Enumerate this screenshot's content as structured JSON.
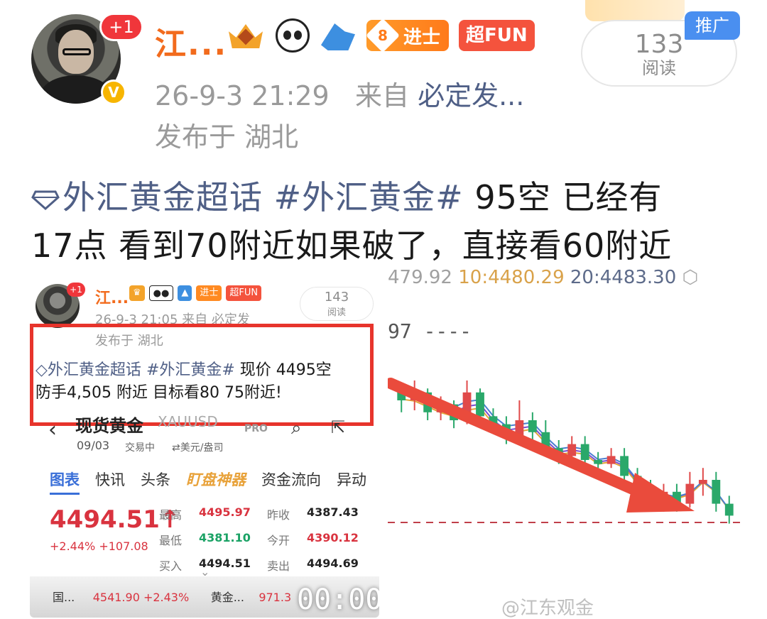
{
  "header": {
    "username": "江...",
    "plus_badge": "+1",
    "level_badge": "8",
    "level_title": "进士",
    "fun_badge": "超FUN",
    "date_time": "26-9-3 21:29",
    "source_prefix": "来自",
    "source_app": "必定发...",
    "location": "发布于 湖北",
    "read_count": "133",
    "read_label": "阅读",
    "promo_tag": "推广"
  },
  "post": {
    "topic1": "外汇黄金超话",
    "topic2": "#外汇黄金#",
    "text_line1": " 95空 已经有",
    "text_line2": "17点 看到70附近如果破了，直接看60附近"
  },
  "left_screenshot": {
    "name": "江...",
    "read_count": "143",
    "read_label": "阅读",
    "level_title": "进士",
    "fun_badge": "超FUN",
    "meta": "26-9-3 21:05 来自 必定发",
    "location": "发布于 湖北",
    "topic1": "外汇黄金超话",
    "topic2": "#外汇黄金#",
    "post_line1": " 现价 4495空",
    "post_line2": "防手4,505 附近 目标看80  75附近!",
    "app": {
      "title": "现货黄金",
      "symbol": "XAUUSD",
      "pro": "PRO",
      "date": "09/03",
      "status": "交易中",
      "unit": "⇄美元/盎司",
      "tabs": [
        "图表",
        "快讯",
        "头条",
        "盯盘神器",
        "资金流向",
        "异动"
      ],
      "price": "4494.51↑",
      "change": "+2.44%  +107.08",
      "quotes": [
        {
          "k": "最高",
          "v": "4495.97",
          "c": "up"
        },
        {
          "k": "昨收",
          "v": "4387.43",
          "c": "v"
        },
        {
          "k": "最低",
          "v": "4381.10",
          "c": "dn"
        },
        {
          "k": "今开",
          "v": "4390.12",
          "c": "up"
        },
        {
          "k": "买入",
          "v": "4494.51",
          "c": "v"
        },
        {
          "k": "卖出",
          "v": "4494.69",
          "c": "v"
        }
      ],
      "ticker_name": "国...",
      "ticker_value": "4541.90 +2.43%",
      "ticker_name2": "黄金...",
      "ticker_value2": "971.3",
      "timestamp": "00:00"
    }
  },
  "chart": {
    "header_left": "479.92",
    "header_mid": "10:4480.29",
    "header_right": "20:4483.30",
    "level_label": "97 ----",
    "watermark": "@江东观金",
    "colors": {
      "up": "#e04a4a",
      "down": "#2aa86a",
      "arrow": "#ea4b3c",
      "ma5": "#7a4fd0",
      "ma10": "#e2a43a",
      "ma20": "#4a7fd0"
    },
    "candles": [
      {
        "o": 0.24,
        "c": 0.3,
        "h": 0.22,
        "l": 0.36,
        "t": "dn"
      },
      {
        "o": 0.3,
        "c": 0.26,
        "h": 0.2,
        "l": 0.35,
        "t": "up"
      },
      {
        "o": 0.26,
        "c": 0.36,
        "h": 0.24,
        "l": 0.4,
        "t": "dn"
      },
      {
        "o": 0.36,
        "c": 0.32,
        "h": 0.28,
        "l": 0.4,
        "t": "up"
      },
      {
        "o": 0.32,
        "c": 0.4,
        "h": 0.3,
        "l": 0.44,
        "t": "dn"
      },
      {
        "o": 0.4,
        "c": 0.26,
        "h": 0.2,
        "l": 0.42,
        "t": "up"
      },
      {
        "o": 0.26,
        "c": 0.38,
        "h": 0.24,
        "l": 0.42,
        "t": "dn"
      },
      {
        "o": 0.38,
        "c": 0.42,
        "h": 0.34,
        "l": 0.46,
        "t": "dn"
      },
      {
        "o": 0.42,
        "c": 0.48,
        "h": 0.38,
        "l": 0.52,
        "t": "dn"
      },
      {
        "o": 0.48,
        "c": 0.4,
        "h": 0.3,
        "l": 0.52,
        "t": "up"
      },
      {
        "o": 0.4,
        "c": 0.46,
        "h": 0.36,
        "l": 0.5,
        "t": "dn"
      },
      {
        "o": 0.46,
        "c": 0.54,
        "h": 0.4,
        "l": 0.58,
        "t": "dn"
      },
      {
        "o": 0.54,
        "c": 0.58,
        "h": 0.5,
        "l": 0.62,
        "t": "dn"
      },
      {
        "o": 0.58,
        "c": 0.52,
        "h": 0.48,
        "l": 0.6,
        "t": "up"
      },
      {
        "o": 0.52,
        "c": 0.6,
        "h": 0.48,
        "l": 0.64,
        "t": "dn"
      },
      {
        "o": 0.6,
        "c": 0.62,
        "h": 0.56,
        "l": 0.66,
        "t": "dn"
      },
      {
        "o": 0.62,
        "c": 0.58,
        "h": 0.54,
        "l": 0.64,
        "t": "up"
      },
      {
        "o": 0.58,
        "c": 0.68,
        "h": 0.54,
        "l": 0.72,
        "t": "dn"
      },
      {
        "o": 0.68,
        "c": 0.74,
        "h": 0.64,
        "l": 0.78,
        "t": "dn"
      },
      {
        "o": 0.74,
        "c": 0.8,
        "h": 0.7,
        "l": 0.84,
        "t": "dn"
      },
      {
        "o": 0.8,
        "c": 0.76,
        "h": 0.72,
        "l": 0.86,
        "t": "up"
      },
      {
        "o": 0.76,
        "c": 0.82,
        "h": 0.72,
        "l": 0.86,
        "t": "dn"
      },
      {
        "o": 0.82,
        "c": 0.72,
        "h": 0.66,
        "l": 0.84,
        "t": "up"
      },
      {
        "o": 0.72,
        "c": 0.7,
        "h": 0.64,
        "l": 0.78,
        "t": "up"
      },
      {
        "o": 0.7,
        "c": 0.82,
        "h": 0.66,
        "l": 0.86,
        "t": "dn"
      },
      {
        "o": 0.82,
        "c": 0.88,
        "h": 0.78,
        "l": 0.92,
        "t": "dn"
      }
    ]
  }
}
